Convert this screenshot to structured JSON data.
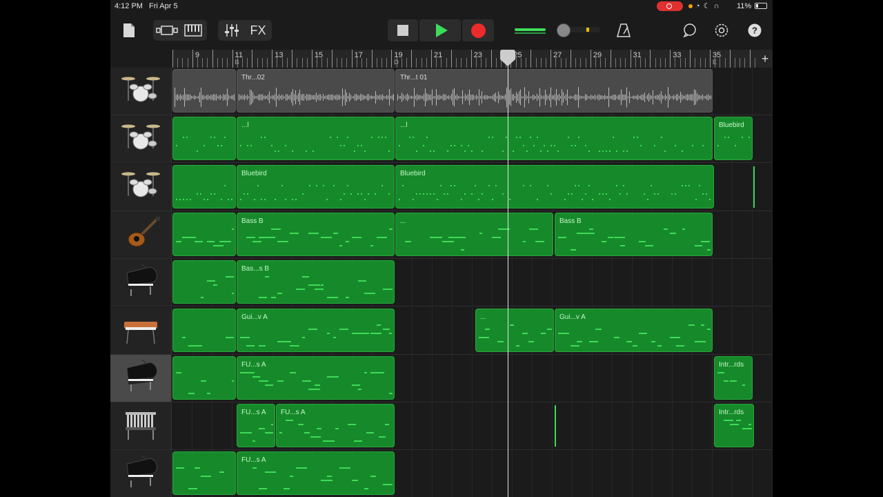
{
  "status_bar": {
    "time": "4:12 PM",
    "date": "Fri Apr 5",
    "battery": "11%"
  },
  "toolbar": {
    "fx_label": "FX"
  },
  "ruler": {
    "bars": [
      "9",
      "11",
      "13",
      "15",
      "17",
      "19",
      "21",
      "23",
      "25",
      "27",
      "29",
      "31",
      "33",
      "35"
    ],
    "sections": {
      "11": "B",
      "19": "D",
      "35": "E"
    }
  },
  "tracks": [
    {
      "instrument": "drum-kit",
      "regions": [
        {
          "label": "Thr...02"
        },
        {
          "label": "Thr...t 01"
        }
      ]
    },
    {
      "instrument": "drum-kit",
      "regions": [
        {
          "label": ""
        },
        {
          "label": "...l"
        },
        {
          "label": "...l"
        },
        {
          "label": "Bluebird"
        }
      ]
    },
    {
      "instrument": "drum-kit",
      "regions": [
        {
          "label": ""
        },
        {
          "label": "Bluebird"
        },
        {
          "label": "Bluebird"
        }
      ]
    },
    {
      "instrument": "bass-guitar",
      "regions": [
        {
          "label": ""
        },
        {
          "label": "Bass B"
        },
        {
          "label": "..."
        },
        {
          "label": "Bass B"
        }
      ]
    },
    {
      "instrument": "grand-piano",
      "regions": [
        {
          "label": ""
        },
        {
          "label": "Bas...s B"
        }
      ]
    },
    {
      "instrument": "electric-piano",
      "regions": [
        {
          "label": ""
        },
        {
          "label": "Gui...v A"
        },
        {
          "label": "..."
        },
        {
          "label": "Gui...v A"
        }
      ]
    },
    {
      "instrument": "grand-piano",
      "regions": [
        {
          "label": ""
        },
        {
          "label": "FU...s A"
        },
        {
          "label": "Intr...rds"
        }
      ]
    },
    {
      "instrument": "vibraphone",
      "regions": [
        {
          "label": "FU...s A"
        },
        {
          "label": "FU...s A"
        },
        {
          "label": "Intr...rds"
        }
      ]
    },
    {
      "instrument": "grand-piano",
      "regions": [
        {
          "label": ""
        },
        {
          "label": "FU...s A"
        }
      ]
    }
  ],
  "colors": {
    "midi_region": "#168a2a",
    "note": "#3ddc58",
    "audio_region": "#4a4a4a",
    "record": "#ec2b2b",
    "play": "#3ddc58"
  }
}
